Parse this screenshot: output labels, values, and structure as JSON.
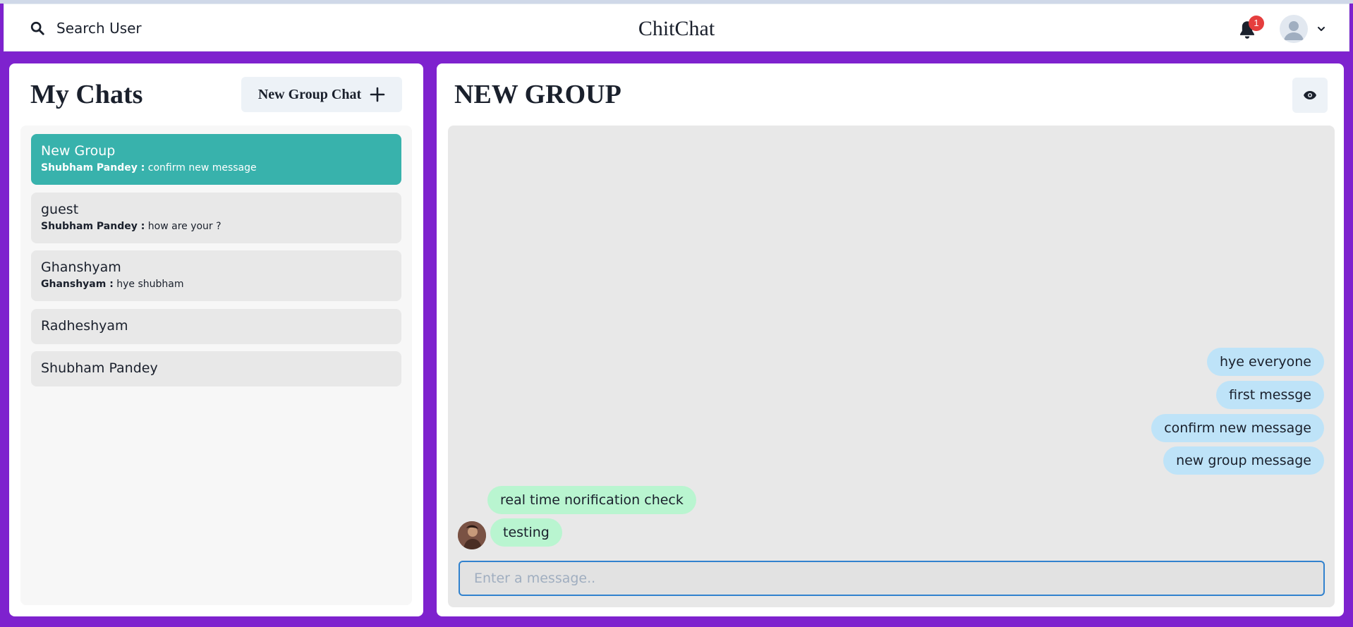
{
  "header": {
    "search_label": "Search User",
    "app_title": "ChitChat",
    "notification_count": "1"
  },
  "sidebar": {
    "title": "My Chats",
    "new_group_label": "New Group Chat",
    "chats": [
      {
        "name": "New Group",
        "latest_sender": "Shubham Pandey :",
        "latest_message": "confirm new message",
        "active": true
      },
      {
        "name": "guest",
        "latest_sender": "Shubham Pandey :",
        "latest_message": "how are your ?",
        "active": false
      },
      {
        "name": "Ghanshyam",
        "latest_sender": "Ghanshyam :",
        "latest_message": "hye shubham",
        "active": false
      },
      {
        "name": "Radheshyam",
        "latest_sender": "",
        "latest_message": "",
        "active": false
      },
      {
        "name": "Shubham Pandey",
        "latest_sender": "",
        "latest_message": "",
        "active": false
      }
    ]
  },
  "chat": {
    "title": "NEW GROUP",
    "messages": [
      {
        "text": "hye everyone",
        "own": true
      },
      {
        "text": "first messge",
        "own": true
      },
      {
        "text": "confirm new message",
        "own": true
      },
      {
        "text": "new group message",
        "own": true
      },
      {
        "text": "real time norification check",
        "own": false
      },
      {
        "text": "testing",
        "own": false
      }
    ],
    "input_placeholder": "Enter a message.."
  },
  "colors": {
    "background": "#7e22ce",
    "active_chat": "#38b2ac",
    "sent_bubble": "#bee3f8",
    "received_bubble": "#b9f5d0",
    "badge": "#e53e3e",
    "input_border": "#3182ce"
  },
  "icons": {
    "search": "search-icon",
    "bell": "bell-icon",
    "avatar": "user-avatar-icon",
    "chevron": "chevron-down-icon",
    "add": "plus-icon",
    "view": "eye-icon"
  }
}
